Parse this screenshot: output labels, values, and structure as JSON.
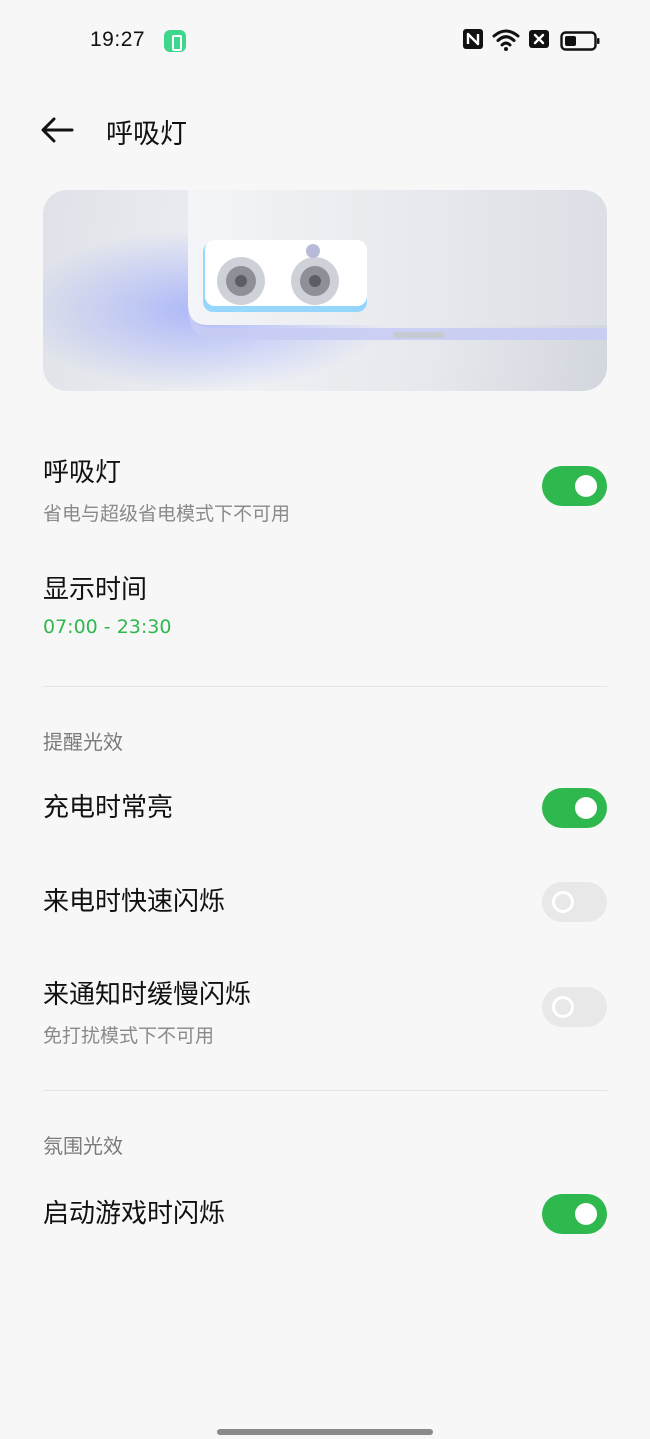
{
  "status_bar": {
    "time": "19:27",
    "icons": [
      "app-notification-icon",
      "nfc-icon",
      "wifi-icon",
      "sim-disabled-icon",
      "battery-icon"
    ]
  },
  "header": {
    "title": "呼吸灯",
    "back_icon": "back-arrow-icon"
  },
  "colors": {
    "accent": "#2fb84e",
    "toggle_off": "#e8e8e8",
    "background": "#f7f7f7"
  },
  "settings": {
    "breathing_light": {
      "title": "呼吸灯",
      "subtitle": "省电与超级省电模式下不可用",
      "enabled": true
    },
    "display_time": {
      "title": "显示时间",
      "value": "07:00 - 23:30"
    }
  },
  "sections": {
    "reminder": {
      "header": "提醒光效",
      "charging": {
        "title": "充电时常亮",
        "enabled": true
      },
      "incoming_call": {
        "title": "来电时快速闪烁",
        "enabled": false
      },
      "notification": {
        "title": "来通知时缓慢闪烁",
        "subtitle": "免打扰模式下不可用",
        "enabled": false
      }
    },
    "ambient": {
      "header": "氛围光效",
      "game_launch": {
        "title": "启动游戏时闪烁",
        "enabled": true
      }
    }
  }
}
